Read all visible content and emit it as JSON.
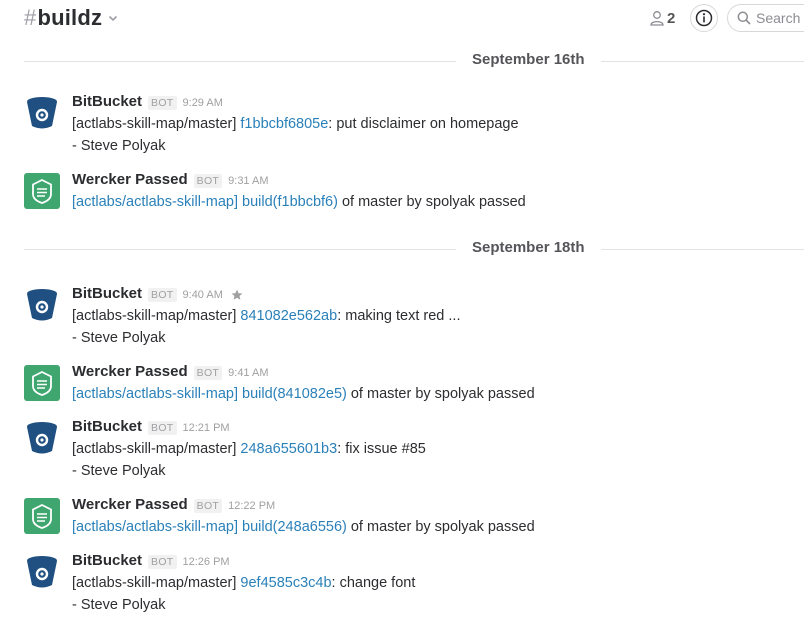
{
  "header": {
    "hash": "#",
    "channel_name": "buildz",
    "member_count": "2",
    "search_placeholder": "Search",
    "icons": {
      "chevron": "chevron-down-icon",
      "members": "person-icon",
      "info": "info-icon",
      "search": "search-icon"
    }
  },
  "colors": {
    "link": "#2a80b9",
    "wercker_green": "#3fa66f",
    "bitbucket_navy": "#205081"
  },
  "days": [
    {
      "label": "September 16th"
    },
    {
      "label": "September 18th"
    }
  ],
  "messages": [
    {
      "sender": "BitBucket",
      "badge": "BOT",
      "time": "9:29 AM",
      "pre": "[actlabs-skill-map/master] ",
      "link1": "f1bbcbf6805e",
      "mid": "",
      "link2": "",
      "post": ": put disclaimer on homepage",
      "line2": "- Steve Polyak"
    },
    {
      "sender": "Wercker Passed",
      "badge": "BOT",
      "time": "9:31 AM",
      "pre": "",
      "link1": "[actlabs/actlabs-skill-map]",
      "mid": " ",
      "link2": "build(f1bbcbf6)",
      "post": " of master by spolyak passed",
      "line2": ""
    },
    {
      "sender": "BitBucket",
      "badge": "BOT",
      "time": "9:40 AM",
      "pre": "[actlabs-skill-map/master] ",
      "link1": "841082e562ab",
      "mid": "",
      "link2": "",
      "post": ": making text red ...",
      "line2": "- Steve Polyak"
    },
    {
      "sender": "Wercker Passed",
      "badge": "BOT",
      "time": "9:41 AM",
      "pre": "",
      "link1": "[actlabs/actlabs-skill-map]",
      "mid": " ",
      "link2": "build(841082e5)",
      "post": " of master by spolyak passed",
      "line2": ""
    },
    {
      "sender": "BitBucket",
      "badge": "BOT",
      "time": "12:21 PM",
      "pre": "[actlabs-skill-map/master] ",
      "link1": "248a655601b3",
      "mid": "",
      "link2": "",
      "post": ": fix issue #85",
      "line2": "- Steve Polyak"
    },
    {
      "sender": "Wercker Passed",
      "badge": "BOT",
      "time": "12:22 PM",
      "pre": "",
      "link1": "[actlabs/actlabs-skill-map]",
      "mid": " ",
      "link2": "build(248a6556)",
      "post": " of master by spolyak passed",
      "line2": ""
    },
    {
      "sender": "BitBucket",
      "badge": "BOT",
      "time": "12:26 PM",
      "pre": "[actlabs-skill-map/master] ",
      "link1": "9ef4585c3c4b",
      "mid": "",
      "link2": "",
      "post": ": change font",
      "line2": "- Steve Polyak"
    }
  ]
}
